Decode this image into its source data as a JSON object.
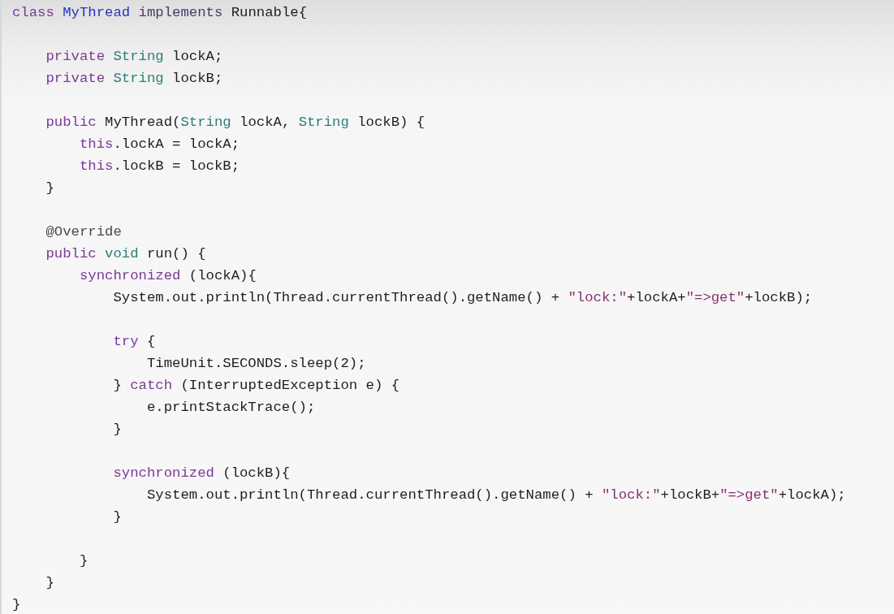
{
  "code": {
    "lines": [
      {
        "kind": "code",
        "tokens": [
          {
            "text": "class ",
            "kind": "keyword"
          },
          {
            "text": "MyThread ",
            "kind": "classname"
          },
          {
            "text": "implements",
            "kind": "keyword2"
          },
          {
            "text": " Runnable{",
            "kind": "plain"
          }
        ]
      },
      {
        "kind": "blank"
      },
      {
        "kind": "code",
        "tokens": [
          {
            "text": "    private ",
            "kind": "keyword"
          },
          {
            "text": "String",
            "kind": "type"
          },
          {
            "text": " lockA;",
            "kind": "plain"
          }
        ]
      },
      {
        "kind": "code",
        "tokens": [
          {
            "text": "    private ",
            "kind": "keyword"
          },
          {
            "text": "String",
            "kind": "type"
          },
          {
            "text": " lockB;",
            "kind": "plain"
          }
        ]
      },
      {
        "kind": "blank"
      },
      {
        "kind": "code",
        "tokens": [
          {
            "text": "    public ",
            "kind": "keyword"
          },
          {
            "text": "MyThread(",
            "kind": "plain"
          },
          {
            "text": "String",
            "kind": "type"
          },
          {
            "text": " lockA, ",
            "kind": "plain"
          },
          {
            "text": "String",
            "kind": "type"
          },
          {
            "text": " lockB) {",
            "kind": "plain"
          }
        ]
      },
      {
        "kind": "code",
        "tokens": [
          {
            "text": "        this",
            "kind": "keyword"
          },
          {
            "text": ".lockA = lockA;",
            "kind": "plain"
          }
        ]
      },
      {
        "kind": "code",
        "tokens": [
          {
            "text": "        this",
            "kind": "keyword"
          },
          {
            "text": ".lockB = lockB;",
            "kind": "plain"
          }
        ]
      },
      {
        "kind": "code",
        "tokens": [
          {
            "text": "    }",
            "kind": "plain"
          }
        ]
      },
      {
        "kind": "blank"
      },
      {
        "kind": "code",
        "tokens": [
          {
            "text": "    @Override",
            "kind": "annotation"
          }
        ]
      },
      {
        "kind": "code",
        "tokens": [
          {
            "text": "    public ",
            "kind": "keyword"
          },
          {
            "text": "void",
            "kind": "type"
          },
          {
            "text": " run() {",
            "kind": "plain"
          }
        ]
      },
      {
        "kind": "code",
        "tokens": [
          {
            "text": "        synchronized",
            "kind": "keyword"
          },
          {
            "text": " (lockA){",
            "kind": "plain"
          }
        ]
      },
      {
        "kind": "code",
        "tokens": [
          {
            "text": "            System.out.println(Thread.currentThread().getName() + ",
            "kind": "plain"
          },
          {
            "text": "\"lock:\"",
            "kind": "string"
          },
          {
            "text": "+lockA+",
            "kind": "plain"
          },
          {
            "text": "\"=>get\"",
            "kind": "string"
          },
          {
            "text": "+lockB);",
            "kind": "plain"
          }
        ]
      },
      {
        "kind": "blank"
      },
      {
        "kind": "code",
        "tokens": [
          {
            "text": "            try",
            "kind": "keyword"
          },
          {
            "text": " {",
            "kind": "plain"
          }
        ]
      },
      {
        "kind": "code",
        "tokens": [
          {
            "text": "                TimeUnit.SECONDS.sleep(2);",
            "kind": "plain"
          }
        ]
      },
      {
        "kind": "code",
        "tokens": [
          {
            "text": "            } ",
            "kind": "plain"
          },
          {
            "text": "catch",
            "kind": "keyword"
          },
          {
            "text": " (InterruptedException e) {",
            "kind": "plain"
          }
        ]
      },
      {
        "kind": "code",
        "tokens": [
          {
            "text": "                e.printStackTrace();",
            "kind": "plain"
          }
        ]
      },
      {
        "kind": "code",
        "tokens": [
          {
            "text": "            }",
            "kind": "plain"
          }
        ]
      },
      {
        "kind": "blank"
      },
      {
        "kind": "code",
        "tokens": [
          {
            "text": "            synchronized",
            "kind": "keyword"
          },
          {
            "text": " (lockB){",
            "kind": "plain"
          }
        ]
      },
      {
        "kind": "code",
        "tokens": [
          {
            "text": "                System.out.println(Thread.currentThread().getName() + ",
            "kind": "plain"
          },
          {
            "text": "\"lock:\"",
            "kind": "string"
          },
          {
            "text": "+lockB+",
            "kind": "plain"
          },
          {
            "text": "\"=>get\"",
            "kind": "string"
          },
          {
            "text": "+lockA);",
            "kind": "plain"
          }
        ]
      },
      {
        "kind": "code",
        "tokens": [
          {
            "text": "            }",
            "kind": "plain"
          }
        ]
      },
      {
        "kind": "blank"
      },
      {
        "kind": "code",
        "tokens": [
          {
            "text": "        }",
            "kind": "plain"
          }
        ]
      },
      {
        "kind": "code",
        "tokens": [
          {
            "text": "    }",
            "kind": "plain"
          }
        ]
      },
      {
        "kind": "code",
        "tokens": [
          {
            "text": "}",
            "kind": "plain"
          }
        ]
      }
    ]
  }
}
